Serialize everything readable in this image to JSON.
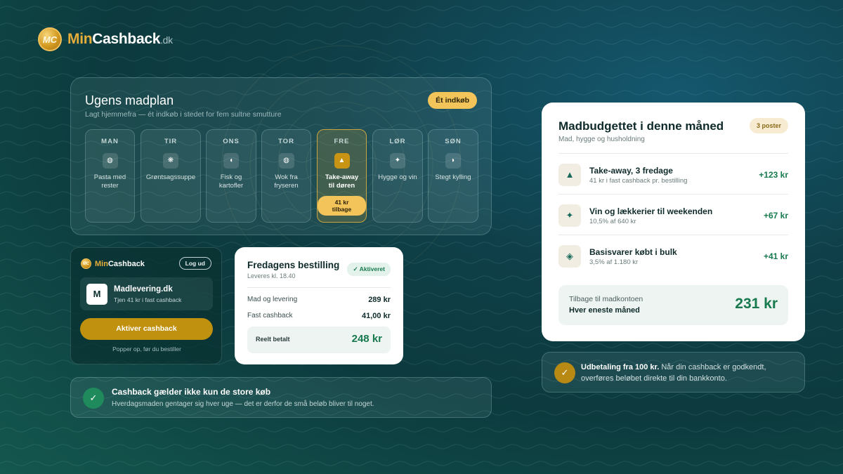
{
  "brand": {
    "logo_mark": "MC",
    "name_part1": "Min",
    "name_part2": "Cashback",
    "tld": ".dk"
  },
  "meal_plan": {
    "title": "Ugens madplan",
    "subtitle": "Lagt hjemmefra — ét indkøb i stedet for fem sultne smutture",
    "badge": "Ét indkøb",
    "days": [
      {
        "day": "MAN",
        "icon": "◍",
        "meal": "Pasta med rester"
      },
      {
        "day": "TIR",
        "icon": "❋",
        "meal": "Grøntsagssuppe"
      },
      {
        "day": "ONS",
        "icon": "◖",
        "meal": "Fisk og kartofler"
      },
      {
        "day": "TOR",
        "icon": "◍",
        "meal": "Wok fra fryseren"
      },
      {
        "day": "FRE",
        "icon": "▲",
        "meal": "Take-away til døren",
        "cashback_badge": "41 kr tilbage"
      },
      {
        "day": "LØR",
        "icon": "✦",
        "meal": "Hygge og vin"
      },
      {
        "day": "SØN",
        "icon": "◗",
        "meal": "Stegt kylling"
      }
    ]
  },
  "extension": {
    "logo_mark": "MC",
    "brand_part1": "Min",
    "brand_part2": "Cashback",
    "logout": "Log ud",
    "shop_initial": "M",
    "shop_name": "Madlevering.dk",
    "shop_offer": "Tjen 41 kr i fast cashback",
    "activate": "Aktiver cashback",
    "note": "Popper op, før du bestiller"
  },
  "order": {
    "title": "Fredagens bestilling",
    "delivery": "Leveres kl. 18.40",
    "badge": "Aktiveret",
    "rows": [
      {
        "label": "Mad og levering",
        "value": "289 kr"
      },
      {
        "label": "Fast cashback",
        "value": "41,00 kr"
      }
    ],
    "total_label": "Reelt betalt",
    "total_value": "248 kr"
  },
  "info": {
    "title": "Cashback gælder ikke kun de store køb",
    "text": "Hverdagsmaden gentager sig hver uge — det er derfor de små beløb bliver til noget."
  },
  "budget": {
    "title": "Madbudgettet i denne måned",
    "subtitle": "Mad, hygge og husholdning",
    "badge": "3 poster",
    "items": [
      {
        "icon": "▲",
        "name": "Take-away, 3 fredage",
        "desc": "41 kr i fast cashback pr. bestilling",
        "value": "+123 kr"
      },
      {
        "icon": "✦",
        "name": "Vin og lækkerier til weekenden",
        "desc": "10,5% af 640 kr",
        "value": "+67 kr"
      },
      {
        "icon": "◈",
        "name": "Basisvarer købt i bulk",
        "desc": "3,5% af 1.180 kr",
        "value": "+41 kr"
      }
    ],
    "total_label1": "Tilbage til madkontoen",
    "total_label2": "Hver eneste måned",
    "total_value": "231 kr"
  },
  "payout": {
    "bold": "Udbetaling fra 100 kr.",
    "text": " Når din cashback er godkendt, overføres beløbet direkte til din bankkonto."
  },
  "colors": {
    "accent_gold": "#f2c45a",
    "positive_green": "#17794e",
    "background_teal": "#0f3f48"
  }
}
